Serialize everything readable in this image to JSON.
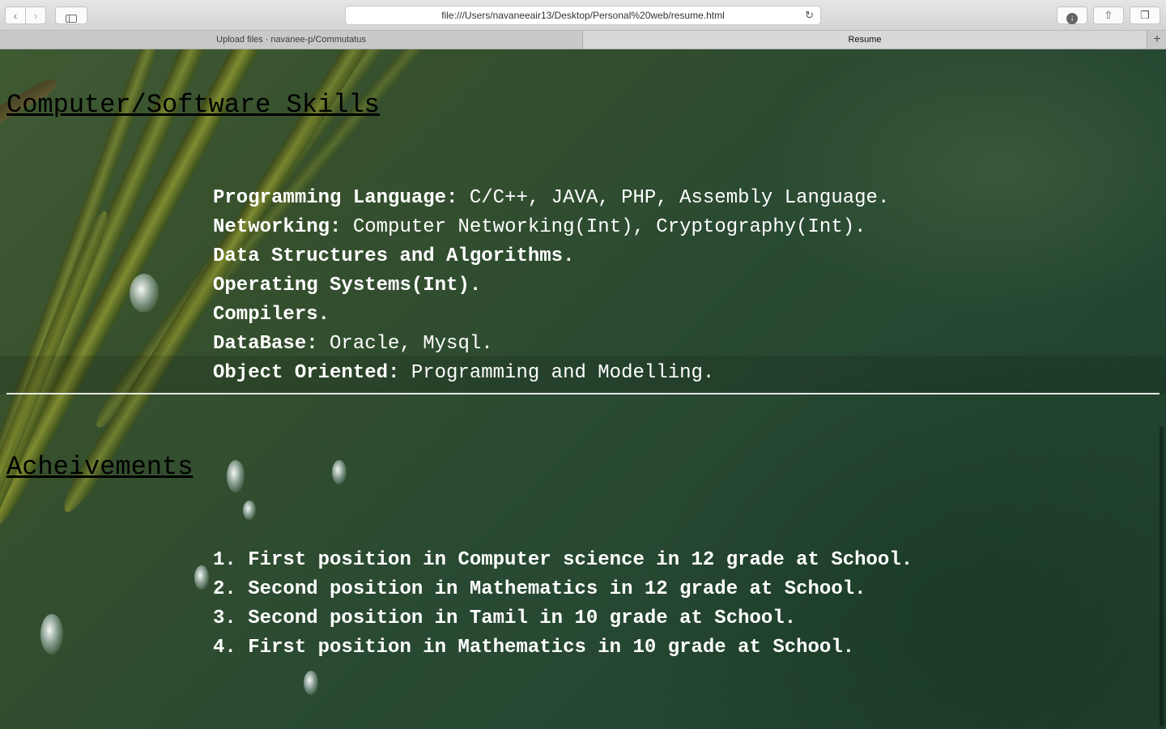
{
  "browser": {
    "back_icon": "‹",
    "forward_icon": "›",
    "url": "file:///Users/navaneeair13/Desktop/Personal%20web/resume.html",
    "reload_icon": "↻",
    "download_icon": "↓",
    "share_icon": "⇧",
    "tabs_icon": "❐",
    "new_tab_icon": "+"
  },
  "tabs": [
    {
      "label": "Upload files · navanee-p/Commutatus",
      "active": false
    },
    {
      "label": "Resume",
      "active": true
    }
  ],
  "skills": {
    "heading": "Computer/Software Skills",
    "items": [
      {
        "key": "Programming Language:",
        "value": " C/C++, JAVA, PHP, Assembly Language."
      },
      {
        "key": "Networking:",
        "value": " Computer Networking(Int), Cryptography(Int)."
      },
      {
        "key": "Data Structures and Algorithms.",
        "value": ""
      },
      {
        "key": "Operating Systems(Int).",
        "value": ""
      },
      {
        "key": "Compilers.",
        "value": ""
      },
      {
        "key": "DataBase:",
        "value": " Oracle, Mysql."
      },
      {
        "key": "Object Oriented:",
        "value": " Programming and Modelling."
      }
    ]
  },
  "achievements": {
    "heading": "Acheivements",
    "items": [
      "1. First position in Computer science in 12 grade at School.",
      "2. Second position in Mathematics in 12 grade at School.",
      "3. Second position in Tamil in 10 grade at School.",
      "4. First position in Mathematics in 10 grade at School."
    ]
  }
}
